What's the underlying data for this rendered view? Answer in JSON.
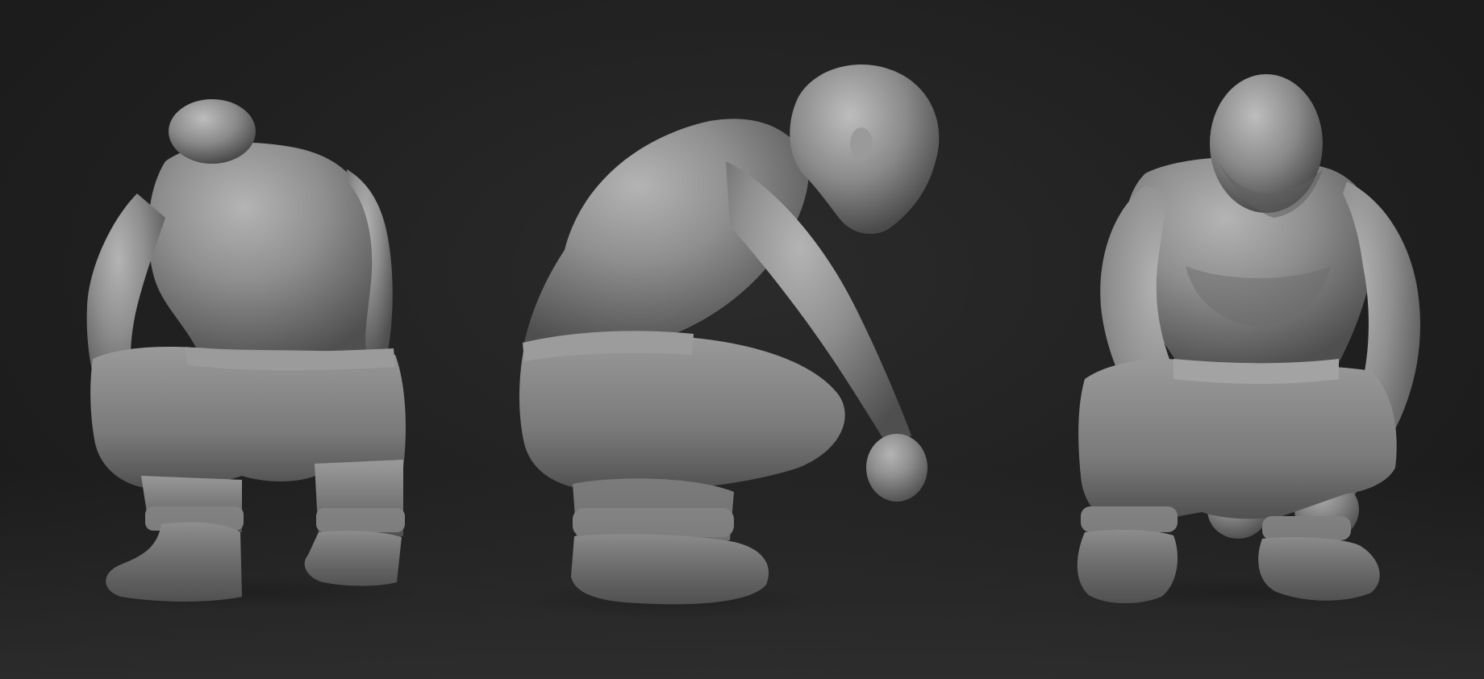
{
  "scene": {
    "background_color": "#222222",
    "model_color": "#8e8e8e",
    "views": [
      {
        "name": "back-view"
      },
      {
        "name": "side-view"
      },
      {
        "name": "front-view"
      }
    ]
  }
}
